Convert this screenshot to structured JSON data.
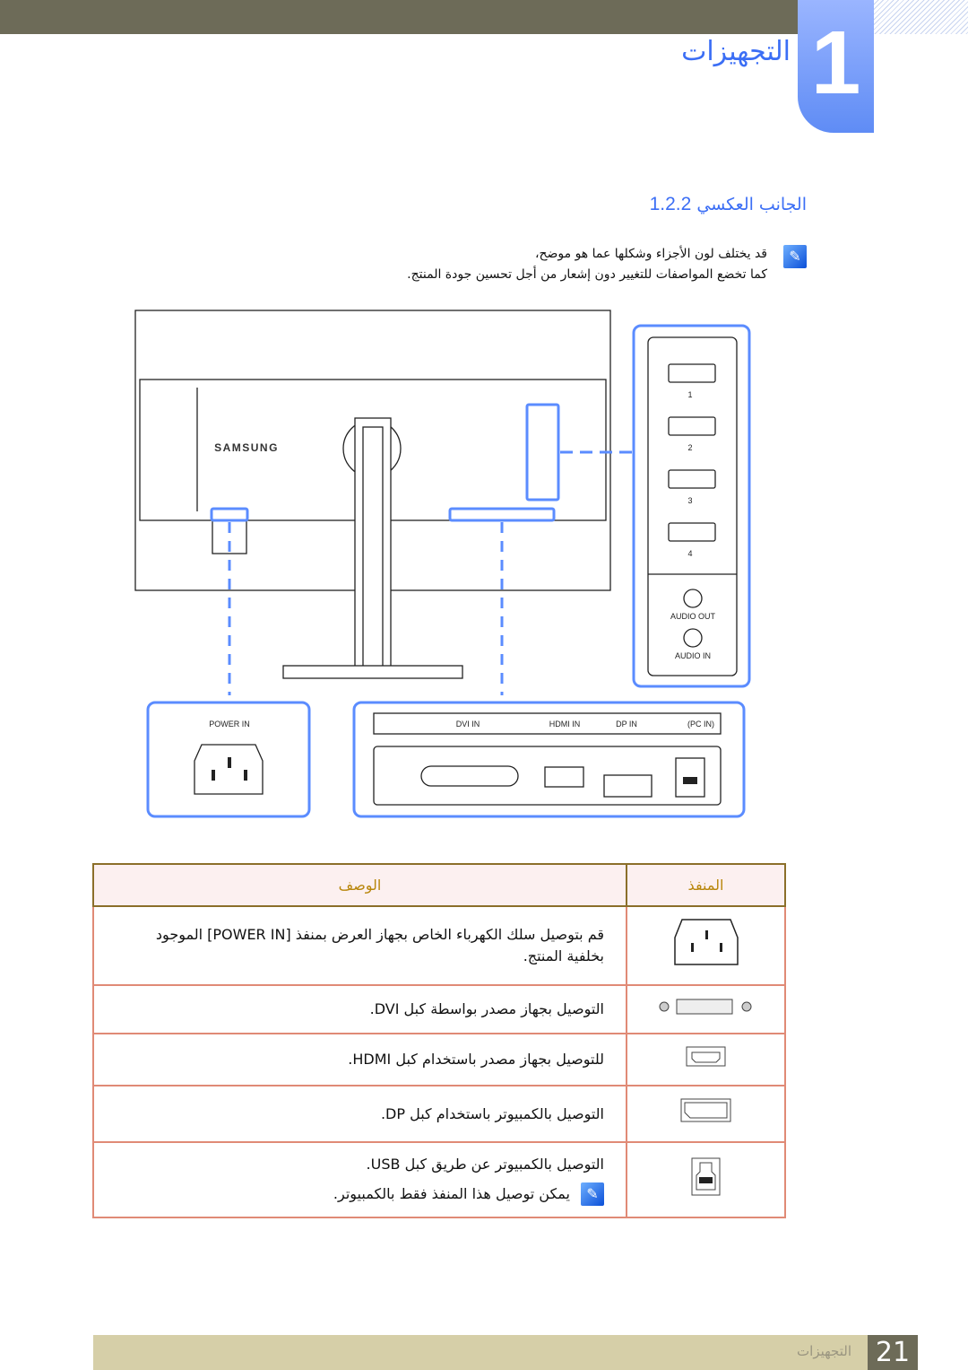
{
  "header": {
    "chapter_number": "1",
    "chapter_title": "التجهيزات"
  },
  "section": {
    "number": "1.2.2",
    "title": "الجانب العكسي"
  },
  "note": {
    "icon": "note-pencil-icon",
    "line1": "قد يختلف لون الأجزاء وشكلها عما هو موضح،",
    "line2": "كما تخضع المواصفات للتغيير دون إشعار من أجل تحسين جودة المنتج."
  },
  "diagram": {
    "brand": "SAMSUNG",
    "power_in": "POWER IN",
    "dvi_in": "DVI IN",
    "hdmi_in": "HDMI IN",
    "dp_in": "DP IN",
    "pc_in": "(PC IN)",
    "usb_ports": [
      "1",
      "2",
      "3",
      "4"
    ],
    "audio_out": "AUDIO OUT",
    "audio_in": "AUDIO IN",
    "accent": "#5b8cff"
  },
  "table": {
    "headers": {
      "port": "المنفذ",
      "description": "الوصف"
    },
    "rows": [
      {
        "port_icon": "power-socket-icon",
        "description": "قم بتوصيل سلك الكهرباء الخاص بجهاز العرض بمنفذ [POWER IN] الموجود بخلفية المنتج."
      },
      {
        "port_icon": "dvi-port-icon",
        "description": "التوصيل بجهاز مصدر بواسطة كبل DVI."
      },
      {
        "port_icon": "hdmi-port-icon",
        "description": "للتوصيل بجهاز مصدر باستخدام كبل HDMI."
      },
      {
        "port_icon": "displayport-icon",
        "description": "التوصيل بالكمبيوتر باستخدام كبل DP."
      },
      {
        "port_icon": "usb-b-port-icon",
        "description": "التوصيل بالكمبيوتر عن طريق كبل USB.",
        "note": "يمكن توصيل هذا المنفذ فقط بالكمبيوتر."
      }
    ]
  },
  "footer": {
    "label": "التجهيزات",
    "page": "21"
  }
}
